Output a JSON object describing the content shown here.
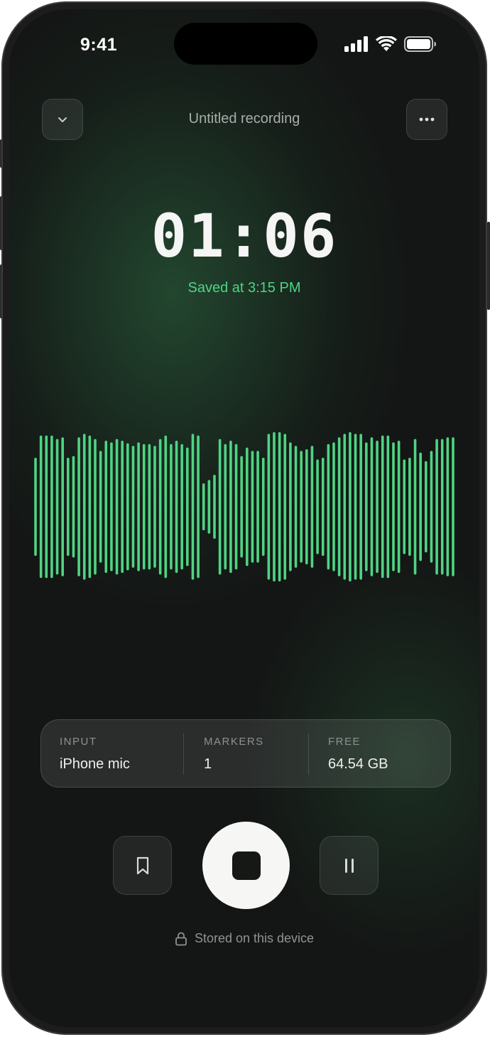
{
  "status_bar": {
    "time": "9:41",
    "icons": [
      "cellular-signal-icon",
      "wifi-icon",
      "battery-icon"
    ]
  },
  "header": {
    "collapse_icon": "chevron-down-icon",
    "title": "Untitled recording",
    "more_icon": "more-horizontal-icon"
  },
  "recording": {
    "elapsed": "01:06",
    "saved_status": "Saved at 3:15 PM"
  },
  "waveform": {
    "color": "#4fd483",
    "bar_levels": [
      0.56,
      0.82,
      0.82,
      0.82,
      0.78,
      0.8,
      0.56,
      0.58,
      0.8,
      0.84,
      0.82,
      0.78,
      0.64,
      0.76,
      0.74,
      0.78,
      0.76,
      0.73,
      0.7,
      0.74,
      0.72,
      0.72,
      0.7,
      0.78,
      0.82,
      0.72,
      0.76,
      0.72,
      0.68,
      0.84,
      0.82,
      0.26,
      0.3,
      0.36,
      0.78,
      0.72,
      0.76,
      0.72,
      0.58,
      0.68,
      0.64,
      0.64,
      0.56,
      0.84,
      0.86,
      0.86,
      0.84,
      0.74,
      0.7,
      0.64,
      0.66,
      0.7,
      0.54,
      0.56,
      0.72,
      0.74,
      0.8,
      0.84,
      0.86,
      0.84,
      0.84,
      0.74,
      0.8,
      0.76,
      0.82,
      0.82,
      0.74,
      0.76,
      0.54,
      0.56,
      0.78,
      0.62,
      0.52,
      0.64,
      0.78,
      0.78,
      0.8,
      0.8
    ]
  },
  "info": {
    "input": {
      "label": "INPUT",
      "value": "iPhone mic"
    },
    "markers": {
      "label": "MARKERS",
      "value": "1"
    },
    "free": {
      "label": "FREE",
      "value": "64.54 GB"
    }
  },
  "controls": {
    "marker_icon": "bookmark-icon",
    "stop_icon": "stop-icon",
    "pause_icon": "pause-icon"
  },
  "footer": {
    "lock_icon": "lock-icon",
    "text": "Stored on this device"
  },
  "colors": {
    "accent": "#4fd483",
    "background": "#141615",
    "stop_button": "#f6f6f4"
  }
}
